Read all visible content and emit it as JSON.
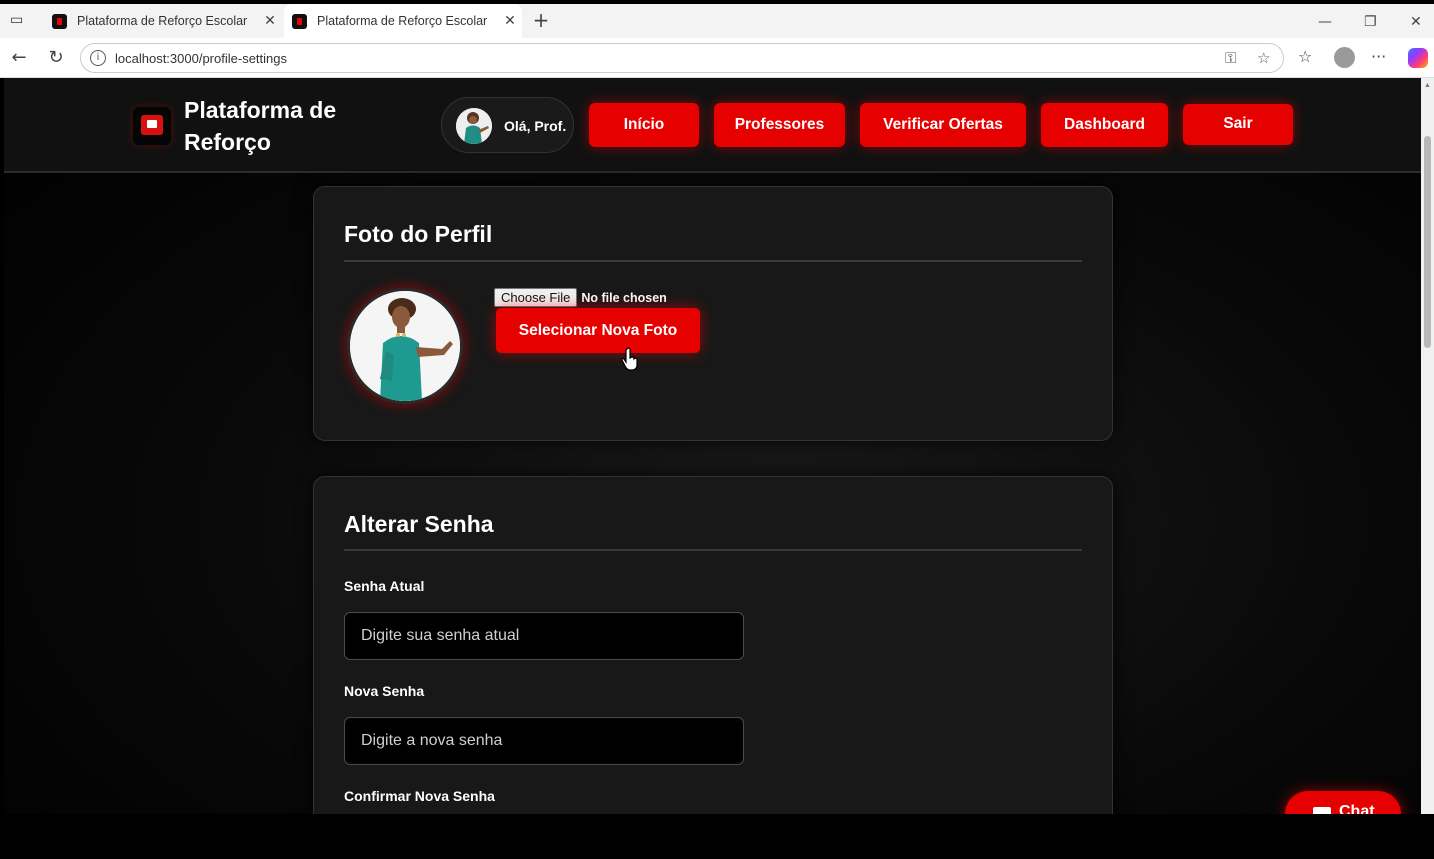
{
  "browser": {
    "tabs": [
      {
        "title": "Plataforma de Reforço Escolar",
        "active": false
      },
      {
        "title": "Plataforma de Reforço Escolar",
        "active": true
      }
    ],
    "url": "localhost:3000/profile-settings"
  },
  "header": {
    "brand": "Plataforma de Reforço",
    "greeting": "Olá, Prof.",
    "nav": {
      "inicio": "Início",
      "professores": "Professores",
      "ofertas": "Verificar Ofertas",
      "dashboard": "Dashboard",
      "sair": "Sair"
    }
  },
  "photo_section": {
    "title": "Foto do Perfil",
    "file_button": "Choose File",
    "file_status": "No file chosen",
    "select_button": "Selecionar Nova Foto"
  },
  "password_section": {
    "title": "Alterar Senha",
    "fields": [
      {
        "label": "Senha Atual",
        "placeholder": "Digite sua senha atual"
      },
      {
        "label": "Nova Senha",
        "placeholder": "Digite a nova senha"
      },
      {
        "label": "Confirmar Nova Senha",
        "placeholder": ""
      }
    ]
  },
  "chat": {
    "label": "Chat"
  },
  "colors": {
    "accent": "#e60000",
    "page_bg": "#000000",
    "card_bg": "#181818"
  }
}
